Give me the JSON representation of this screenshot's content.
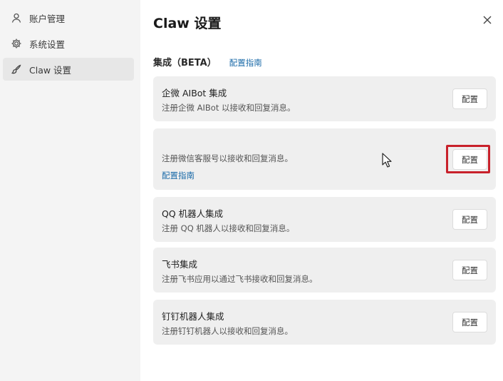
{
  "sidebar": {
    "items": [
      {
        "label": "账户管理",
        "icon": "user-icon"
      },
      {
        "label": "系统设置",
        "icon": "gear-icon"
      },
      {
        "label": "Claw 设置",
        "icon": "brush-icon",
        "active": true
      }
    ]
  },
  "main": {
    "title": "Claw 设置",
    "section": {
      "title": "集成（BETA）",
      "link": "配置指南"
    },
    "cards": [
      {
        "title": "企微 AIBot 集成",
        "desc": "注册企微 AIBot 以接收和回复消息。",
        "button": "配置"
      },
      {
        "title": "",
        "desc": "注册微信客服号以接收和回复消息。",
        "link": "配置指南",
        "button": "配置",
        "highlighted": true
      },
      {
        "title": "QQ 机器人集成",
        "desc": "注册 QQ 机器人以接收和回复消息。",
        "button": "配置"
      },
      {
        "title": "飞书集成",
        "desc": "注册飞书应用以通过飞书接收和回复消息。",
        "button": "配置"
      },
      {
        "title": "钉钉机器人集成",
        "desc": "注册钉钉机器人以接收和回复消息。",
        "button": "配置"
      }
    ]
  },
  "colors": {
    "accent_link": "#1a6aa8",
    "highlight_border": "#c8212b",
    "sidebar_bg": "#f4f4f4",
    "card_bg": "#efefef"
  }
}
